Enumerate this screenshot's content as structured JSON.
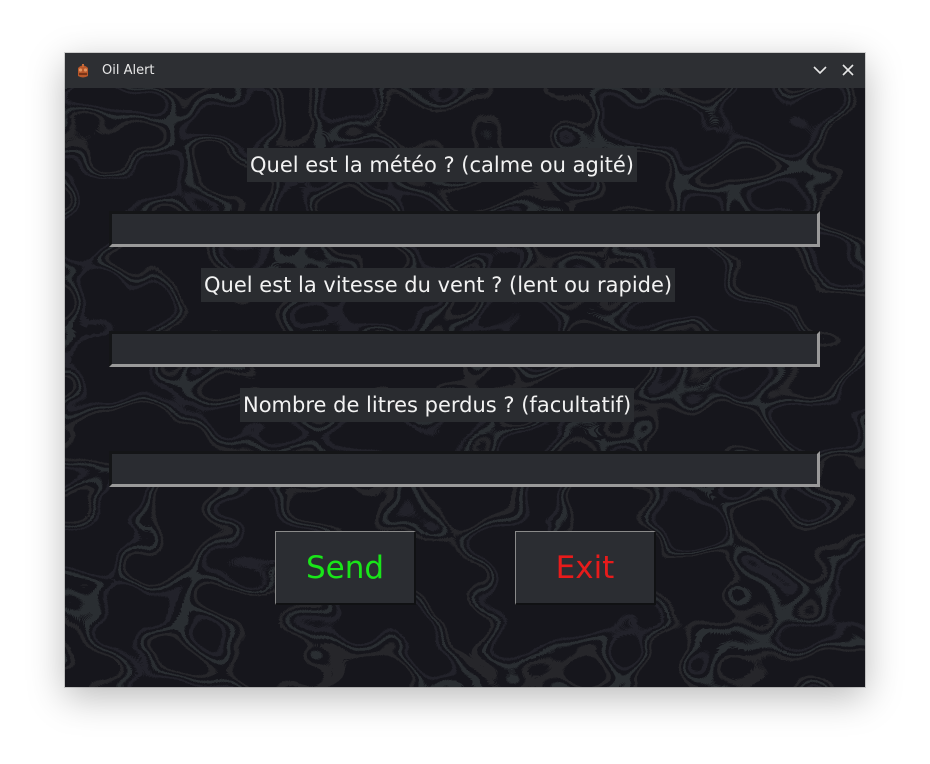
{
  "window": {
    "title": "Oil Alert"
  },
  "form": {
    "weather_label": "Quel est la météo ? (calme ou agité)",
    "weather_value": "",
    "wind_label": "Quel est la vitesse du vent ? (lent ou rapide)",
    "wind_value": "",
    "liters_label": "Nombre de litres perdus ? (facultatif)",
    "liters_value": ""
  },
  "buttons": {
    "send_label": "Send",
    "exit_label": "Exit"
  },
  "colors": {
    "send_text": "#19e619",
    "exit_text": "#e81b1b",
    "background": "#1c1d20",
    "titlebar": "#2d2f33"
  },
  "icons": {
    "app": "oil-barrel-icon",
    "minimize": "chevron-down-icon",
    "close": "close-icon"
  }
}
